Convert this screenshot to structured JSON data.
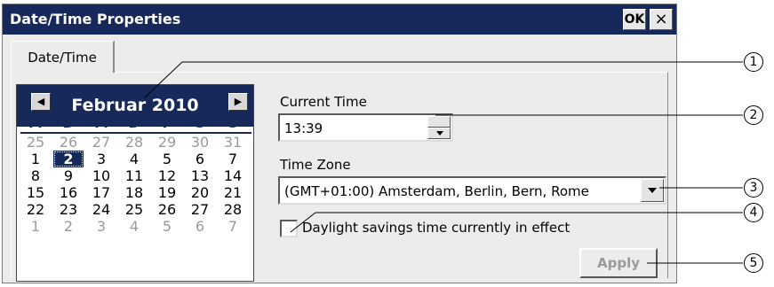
{
  "window": {
    "title": "Date/Time Properties",
    "ok_label": "OK",
    "close_label": "×"
  },
  "tabs": [
    {
      "label": "Date/Time",
      "active": true
    }
  ],
  "calendar": {
    "month_label": "Februar 2010",
    "prev_icon": "triangle-left-icon",
    "next_icon": "triangle-right-icon",
    "weekdays": [
      "M",
      "D",
      "M",
      "D",
      "F",
      "S",
      "S"
    ],
    "weeks": [
      [
        {
          "day": "25",
          "other": true
        },
        {
          "day": "26",
          "other": true
        },
        {
          "day": "27",
          "other": true
        },
        {
          "day": "28",
          "other": true
        },
        {
          "day": "29",
          "other": true
        },
        {
          "day": "30",
          "other": true
        },
        {
          "day": "31",
          "other": true
        }
      ],
      [
        {
          "day": "1"
        },
        {
          "day": "2",
          "selected": true
        },
        {
          "day": "3"
        },
        {
          "day": "4"
        },
        {
          "day": "5"
        },
        {
          "day": "6"
        },
        {
          "day": "7"
        }
      ],
      [
        {
          "day": "8"
        },
        {
          "day": "9"
        },
        {
          "day": "10"
        },
        {
          "day": "11"
        },
        {
          "day": "12"
        },
        {
          "day": "13"
        },
        {
          "day": "14"
        }
      ],
      [
        {
          "day": "15"
        },
        {
          "day": "16"
        },
        {
          "day": "17"
        },
        {
          "day": "18"
        },
        {
          "day": "19"
        },
        {
          "day": "20"
        },
        {
          "day": "21"
        }
      ],
      [
        {
          "day": "22"
        },
        {
          "day": "23"
        },
        {
          "day": "24"
        },
        {
          "day": "25"
        },
        {
          "day": "26"
        },
        {
          "day": "27"
        },
        {
          "day": "28"
        }
      ],
      [
        {
          "day": "1",
          "other": true
        },
        {
          "day": "2",
          "other": true
        },
        {
          "day": "3",
          "other": true
        },
        {
          "day": "4",
          "other": true
        },
        {
          "day": "5",
          "other": true
        },
        {
          "day": "6",
          "other": true
        },
        {
          "day": "7",
          "other": true
        }
      ]
    ]
  },
  "time": {
    "label": "Current Time",
    "value": "13:39"
  },
  "timezone": {
    "label": "Time Zone",
    "selected": "(GMT+01:00) Amsterdam, Berlin, Bern, Rome"
  },
  "dst": {
    "label": "Daylight savings time currently in effect",
    "checked": false
  },
  "apply": {
    "label": "Apply",
    "enabled": false
  },
  "callouts": [
    "1",
    "2",
    "3",
    "4",
    "5"
  ],
  "colors": {
    "title_bar": "#17285a",
    "dialog_bg": "#ececec",
    "disabled_text": "#9a9a9a"
  }
}
